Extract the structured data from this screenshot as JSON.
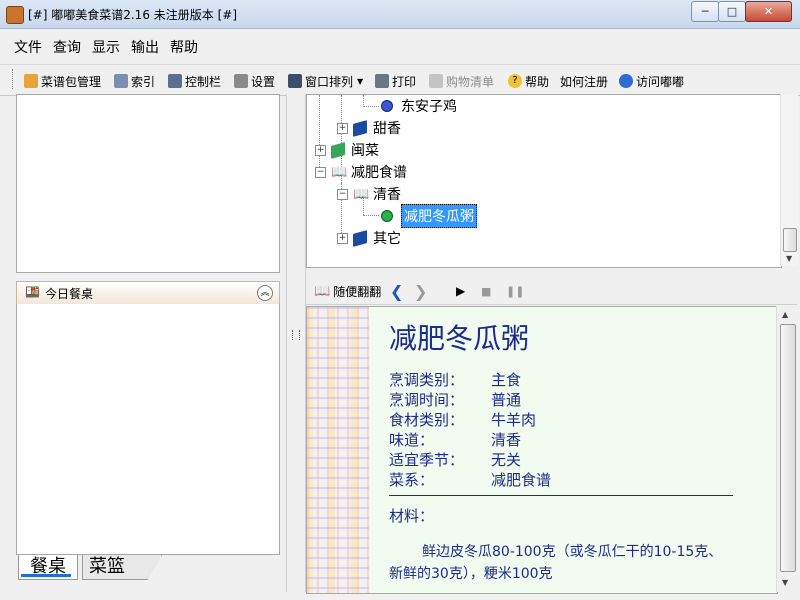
{
  "window": {
    "title": "[#] 嘟嘟美食菜谱2.16  未注册版本 [#]",
    "controls": {
      "minimize": "─",
      "maximize": "□",
      "close": "✕"
    }
  },
  "menu": [
    "文件",
    "查询",
    "显示",
    "输出",
    "帮助"
  ],
  "toolbar": {
    "items": [
      {
        "label": "菜谱包管理",
        "icon": "recipe-package-icon",
        "enabled": true
      },
      {
        "label": "索引",
        "icon": "index-icon",
        "enabled": true
      },
      {
        "label": "控制栏",
        "icon": "control-bar-icon",
        "enabled": true
      },
      {
        "label": "设置",
        "icon": "settings-tools-icon",
        "enabled": true
      },
      {
        "label": "窗口排列",
        "icon": "window-arrange-icon",
        "enabled": true
      },
      {
        "label": "打印",
        "icon": "print-icon",
        "enabled": true
      },
      {
        "label": "购物清单",
        "icon": "shopping-list-icon",
        "enabled": false
      },
      {
        "label": "帮助",
        "icon": "help-icon",
        "enabled": true
      },
      {
        "label": "如何注册",
        "icon": "",
        "enabled": true
      },
      {
        "label": "访问嘟嘟",
        "icon": "globe-icon",
        "enabled": true
      }
    ]
  },
  "left_panel": {
    "today_title": "今日餐桌",
    "tabs": [
      "餐桌",
      "菜篮"
    ],
    "active_tab": "餐桌"
  },
  "tree": {
    "nodes": [
      {
        "label": "东安子鸡",
        "level": 3,
        "type": "recipe"
      },
      {
        "label": "甜香",
        "level": 2,
        "type": "category",
        "expanded": false
      },
      {
        "label": "闽菜",
        "level": 1,
        "type": "cuisine",
        "expanded": false
      },
      {
        "label": "减肥食谱",
        "level": 1,
        "type": "cuisine",
        "expanded": true
      },
      {
        "label": "清香",
        "level": 2,
        "type": "category",
        "expanded": true
      },
      {
        "label": "减肥冬瓜粥",
        "level": 3,
        "type": "recipe",
        "selected": true
      },
      {
        "label": "其它",
        "level": 2,
        "type": "category",
        "expanded": false
      }
    ]
  },
  "reader_toolbar": {
    "browse_label": "随便翻翻"
  },
  "recipe": {
    "title": "减肥冬瓜粥",
    "properties": [
      {
        "label": "烹调类别：",
        "value": "主食"
      },
      {
        "label": "烹调时间：",
        "value": "普通"
      },
      {
        "label": "食材类别：",
        "value": "牛羊肉"
      },
      {
        "label": "味道：",
        "value": "清香"
      },
      {
        "label": "适宜季节：",
        "value": "无关"
      },
      {
        "label": "菜系：",
        "value": "减肥食谱"
      }
    ],
    "materials_label": "材料：",
    "materials_text": "鲜边皮冬瓜80-100克（或冬瓜仁干的10-15克、新鲜的30克），粳米100克"
  },
  "colors": {
    "accent_text": "#1b2c8c",
    "selection": "#3399ff",
    "page_background": "#f2fbf0"
  }
}
